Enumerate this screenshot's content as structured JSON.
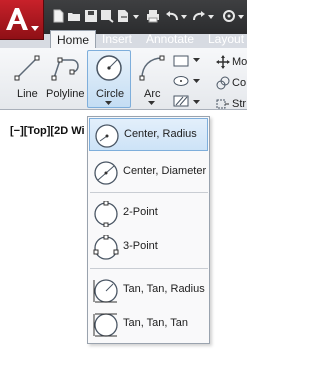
{
  "tabs": {
    "home": "Home",
    "insert": "Insert",
    "annotate": "Annotate",
    "layout": "Layout"
  },
  "ribbon": {
    "line": "Line",
    "polyline": "Polyline",
    "circle": "Circle",
    "arc": "Arc",
    "move_label": "Mo",
    "copy_label": "Co",
    "stretch_label": "Str"
  },
  "viewport": {
    "label": "[−][Top][2D Wi"
  },
  "circle_menu": {
    "items": [
      {
        "label": "Center, Radius",
        "icon": "circle-center-radius-icon",
        "selected": true
      },
      {
        "label": "Center, Diameter",
        "icon": "circle-center-diameter-icon",
        "selected": false
      },
      {
        "label": "2-Point",
        "icon": "circle-2-point-icon",
        "selected": false
      },
      {
        "label": "3-Point",
        "icon": "circle-3-point-icon",
        "selected": false
      },
      {
        "label": "Tan, Tan, Radius",
        "icon": "circle-tan-tan-radius-icon",
        "selected": false
      },
      {
        "label": "Tan, Tan, Tan",
        "icon": "circle-tan-tan-tan-icon",
        "selected": false
      }
    ]
  },
  "colors": {
    "app_button": "#b5161d",
    "title_bar": "#2f3033",
    "selection": "#cde3f7"
  }
}
